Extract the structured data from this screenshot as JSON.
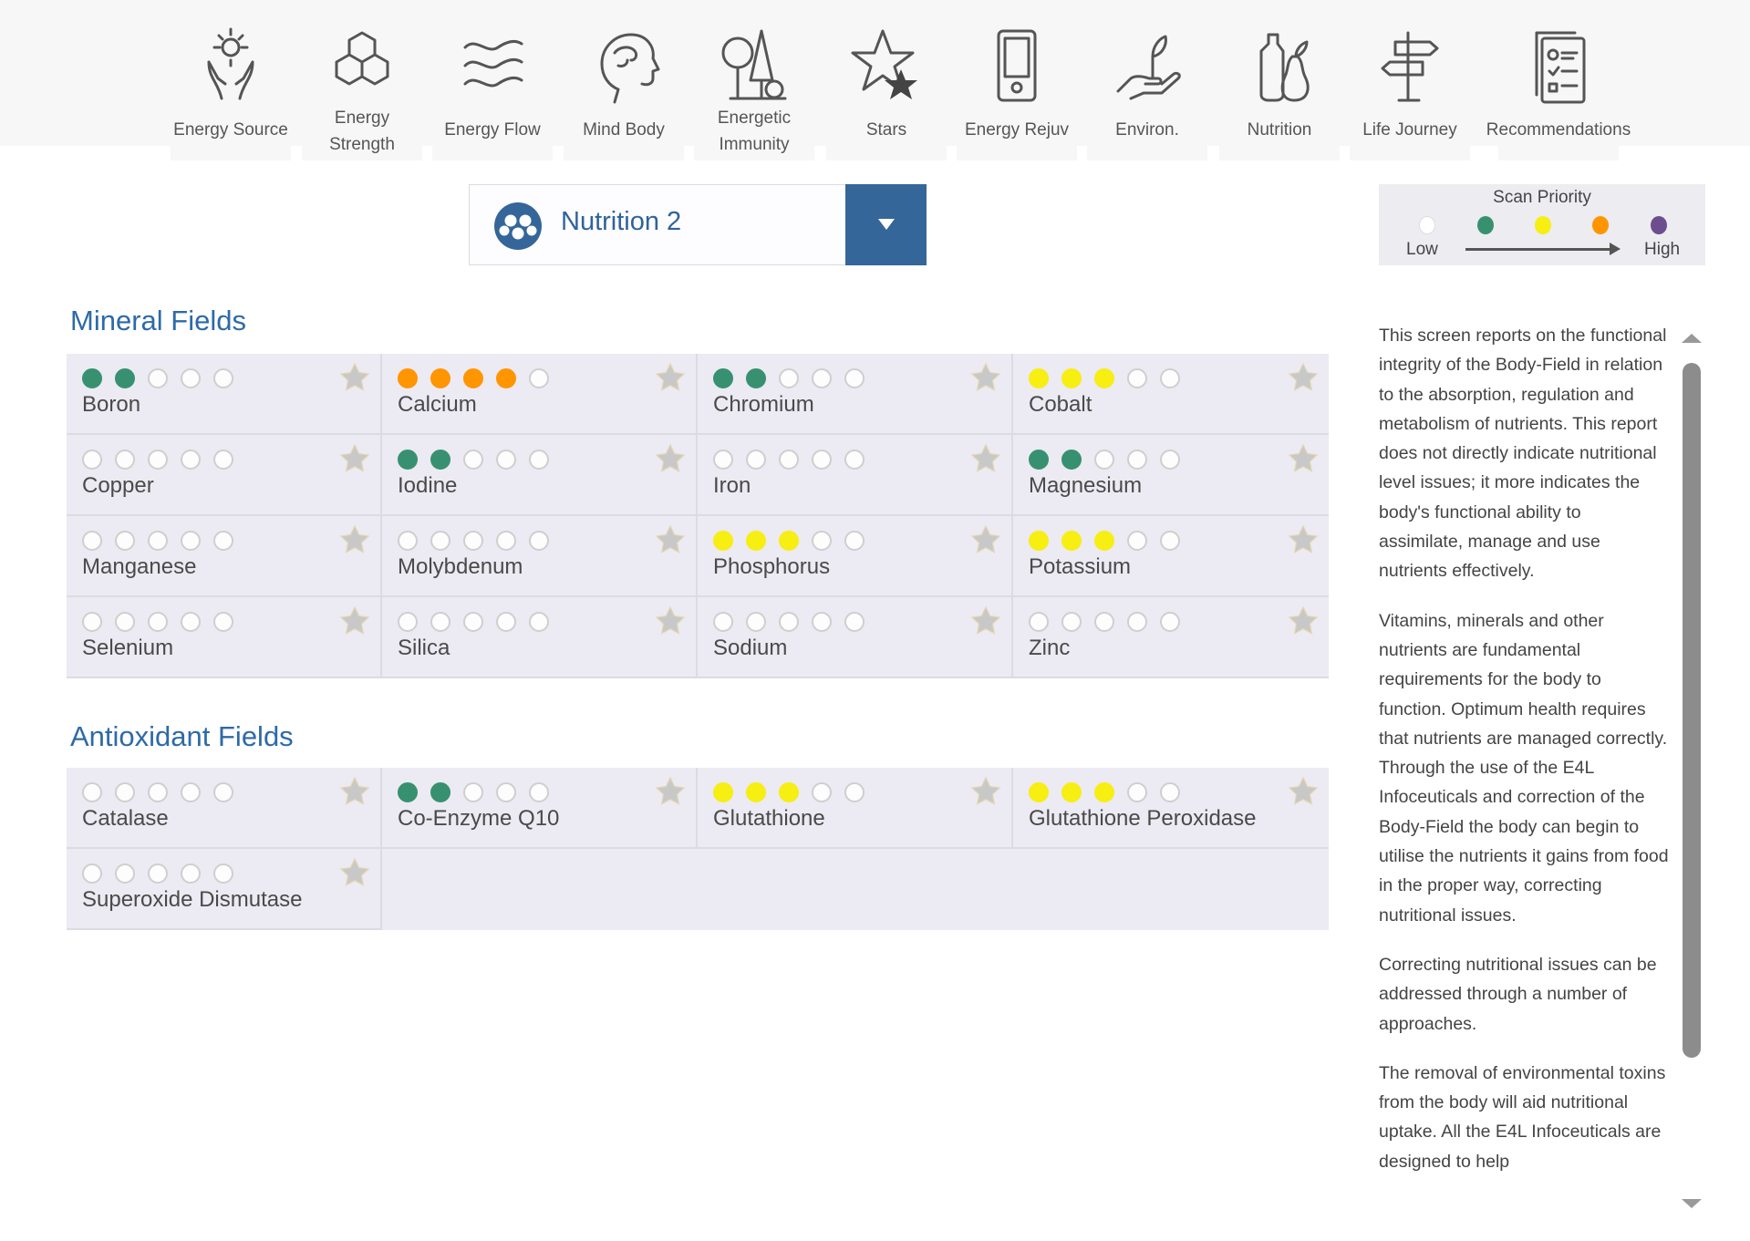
{
  "nav": [
    {
      "label": "Energy Source",
      "icon": "hands-sun-icon"
    },
    {
      "label": "Energy Strength",
      "icon": "hexagons-icon"
    },
    {
      "label": "Energy Flow",
      "icon": "waves-icon"
    },
    {
      "label": "Mind Body",
      "icon": "head-brain-icon"
    },
    {
      "label": "Energetic Immunity",
      "icon": "trees-icon"
    },
    {
      "label": "Stars",
      "icon": "stars-icon"
    },
    {
      "label": "Energy Rejuv",
      "icon": "device-icon"
    },
    {
      "label": "Environ.",
      "icon": "hand-plant-icon"
    },
    {
      "label": "Nutrition",
      "icon": "bottle-pear-icon"
    },
    {
      "label": "Life Journey",
      "icon": "signpost-icon"
    },
    {
      "label": "Recommendations",
      "icon": "clipboard-icon"
    }
  ],
  "dropdown": {
    "selected": "Nutrition 2",
    "icon": "nutrition-molecule-icon"
  },
  "legend": {
    "title": "Scan Priority",
    "low": "Low",
    "high": "High",
    "colors": [
      "#ffffff",
      "#379170",
      "#f7ee12",
      "#ff9500",
      "#6c4e8f"
    ]
  },
  "colors": {
    "green": "#379170",
    "yellow": "#f7ee12",
    "orange": "#ff9500",
    "empty": "#fdfdfd",
    "heading": "#2e6aa8",
    "accent": "#356699"
  },
  "sections": [
    {
      "title": "Mineral Fields",
      "items": [
        {
          "name": "Boron",
          "filled": 2,
          "color": "green"
        },
        {
          "name": "Calcium",
          "filled": 4,
          "color": "orange"
        },
        {
          "name": "Chromium",
          "filled": 2,
          "color": "green"
        },
        {
          "name": "Cobalt",
          "filled": 3,
          "color": "yellow"
        },
        {
          "name": "Copper",
          "filled": 0,
          "color": "green"
        },
        {
          "name": "Iodine",
          "filled": 2,
          "color": "green"
        },
        {
          "name": "Iron",
          "filled": 0,
          "color": "green"
        },
        {
          "name": "Magnesium",
          "filled": 2,
          "color": "green"
        },
        {
          "name": "Manganese",
          "filled": 0,
          "color": "green"
        },
        {
          "name": "Molybdenum",
          "filled": 0,
          "color": "green"
        },
        {
          "name": "Phosphorus",
          "filled": 3,
          "color": "yellow"
        },
        {
          "name": "Potassium",
          "filled": 3,
          "color": "yellow"
        },
        {
          "name": "Selenium",
          "filled": 0,
          "color": "green"
        },
        {
          "name": "Silica",
          "filled": 0,
          "color": "green"
        },
        {
          "name": "Sodium",
          "filled": 0,
          "color": "green"
        },
        {
          "name": "Zinc",
          "filled": 0,
          "color": "green"
        }
      ]
    },
    {
      "title": "Antioxidant Fields",
      "items": [
        {
          "name": "Catalase",
          "filled": 0,
          "color": "green"
        },
        {
          "name": "Co-Enzyme Q10",
          "filled": 2,
          "color": "green"
        },
        {
          "name": "Glutathione",
          "filled": 3,
          "color": "yellow"
        },
        {
          "name": "Glutathione Peroxidase",
          "filled": 3,
          "color": "yellow"
        },
        {
          "name": "Superoxide Dismutase",
          "filled": 0,
          "color": "green"
        }
      ]
    }
  ],
  "info": {
    "paragraphs": [
      "This screen reports on the functional integrity of the Body-Field in relation to the absorption, regulation and metabolism of nutrients. This report does not directly indicate nutritional level issues; it more indicates the body's functional ability to assimilate, manage and use nutrients effectively.",
      "Vitamins, minerals and other nutrients are fundamental requirements for the body to function. Optimum health requires that nutrients are managed correctly. Through the use of the E4L Infoceuticals and correction of the Body-Field the body can begin to utilise the nutrients it gains from food in the proper way, correcting nutritional issues.",
      "Correcting nutritional issues can be addressed through a number of approaches.",
      "The removal of environmental toxins from the body will aid nutritional uptake. All the E4L Infoceuticals are designed to help"
    ]
  }
}
